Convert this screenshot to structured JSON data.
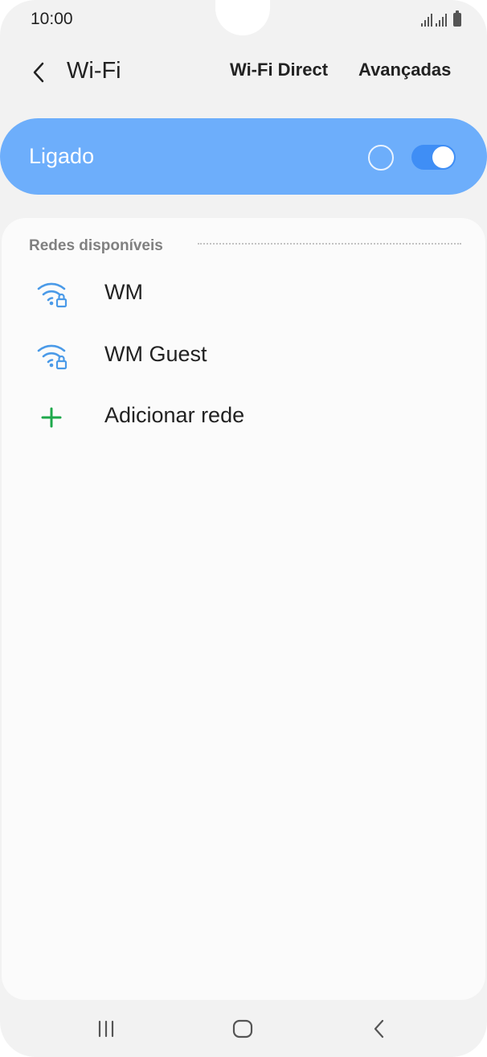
{
  "status_bar": {
    "time": "10:00"
  },
  "header": {
    "title": "Wi-Fi",
    "action_direct": "Wi-Fi Direct",
    "action_advanced": "Avançadas"
  },
  "master_switch": {
    "label": "Ligado",
    "state": "on"
  },
  "networks": {
    "section_title": "Redes disponíveis",
    "items": [
      {
        "name": "WM",
        "icon": "wifi-lock-icon"
      },
      {
        "name": "WM Guest",
        "icon": "wifi-lock-icon"
      }
    ],
    "add_label": "Adicionar rede"
  },
  "colors": {
    "accent": "#6daefb",
    "toggle": "#3f8ef5",
    "wifi_icon": "#4a9ae8",
    "add_icon": "#1ea84b"
  }
}
